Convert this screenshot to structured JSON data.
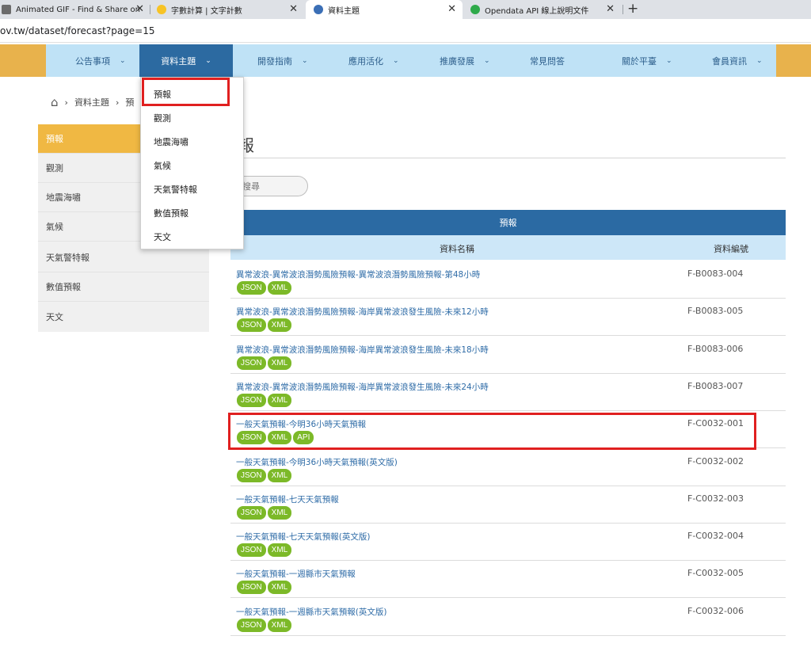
{
  "browser": {
    "tabs": [
      {
        "title": "Animated GIF - Find & Share on",
        "close": "✕"
      },
      {
        "title": "字數計算 | 文字計數",
        "close": "✕"
      },
      {
        "title": "資料主題",
        "close": "✕"
      },
      {
        "title": "Opendata API 線上說明文件",
        "close": "✕"
      }
    ],
    "new_tab": "+",
    "url": "ov.tw/dataset/forecast?page=15"
  },
  "nav": {
    "items": [
      {
        "label": "公告事項"
      },
      {
        "label": "資料主題"
      },
      {
        "label": "開發指南"
      },
      {
        "label": "應用活化"
      },
      {
        "label": "推廣發展"
      },
      {
        "label": "常見問答"
      },
      {
        "label": "關於平臺"
      },
      {
        "label": "會員資訊"
      }
    ],
    "chevron": "⌄"
  },
  "dropdown": {
    "items": [
      "預報",
      "觀測",
      "地震海嘯",
      "氣候",
      "天氣警特報",
      "數值預報",
      "天文"
    ]
  },
  "breadcrumb": {
    "home_icon": "⌂",
    "sep": "›",
    "item1": "資料主題",
    "item2": "預"
  },
  "sidebar": {
    "items": [
      "預報",
      "觀測",
      "地震海嘯",
      "氣候",
      "天氣警特報",
      "數值預報",
      "天文"
    ]
  },
  "main": {
    "title": "報",
    "search_placeholder": "搜尋",
    "table_title": "預報",
    "col_name": "資料名稱",
    "col_code": "資料編號",
    "rows": [
      {
        "name": "異常波浪-異常波浪潛勢風險預報-異常波浪潛勢風險預報-第48小時",
        "code": "F-B0083-004",
        "formats": [
          "JSON",
          "XML"
        ]
      },
      {
        "name": "異常波浪-異常波浪潛勢風險預報-海岸異常波浪發生風險-未來12小時",
        "code": "F-B0083-005",
        "formats": [
          "JSON",
          "XML"
        ]
      },
      {
        "name": "異常波浪-異常波浪潛勢風險預報-海岸異常波浪發生風險-未來18小時",
        "code": "F-B0083-006",
        "formats": [
          "JSON",
          "XML"
        ]
      },
      {
        "name": "異常波浪-異常波浪潛勢風險預報-海岸異常波浪發生風險-未來24小時",
        "code": "F-B0083-007",
        "formats": [
          "JSON",
          "XML"
        ]
      },
      {
        "name": "一般天氣預報-今明36小時天氣預報",
        "code": "F-C0032-001",
        "formats": [
          "JSON",
          "XML",
          "API"
        ]
      },
      {
        "name": "一般天氣預報-今明36小時天氣預報(英文版)",
        "code": "F-C0032-002",
        "formats": [
          "JSON",
          "XML"
        ]
      },
      {
        "name": "一般天氣預報-七天天氣預報",
        "code": "F-C0032-003",
        "formats": [
          "JSON",
          "XML"
        ]
      },
      {
        "name": "一般天氣預報-七天天氣預報(英文版)",
        "code": "F-C0032-004",
        "formats": [
          "JSON",
          "XML"
        ]
      },
      {
        "name": "一般天氣預報-一週縣市天氣預報",
        "code": "F-C0032-005",
        "formats": [
          "JSON",
          "XML"
        ]
      },
      {
        "name": "一般天氣預報-一週縣市天氣預報(英文版)",
        "code": "F-C0032-006",
        "formats": [
          "JSON",
          "XML"
        ]
      }
    ]
  }
}
